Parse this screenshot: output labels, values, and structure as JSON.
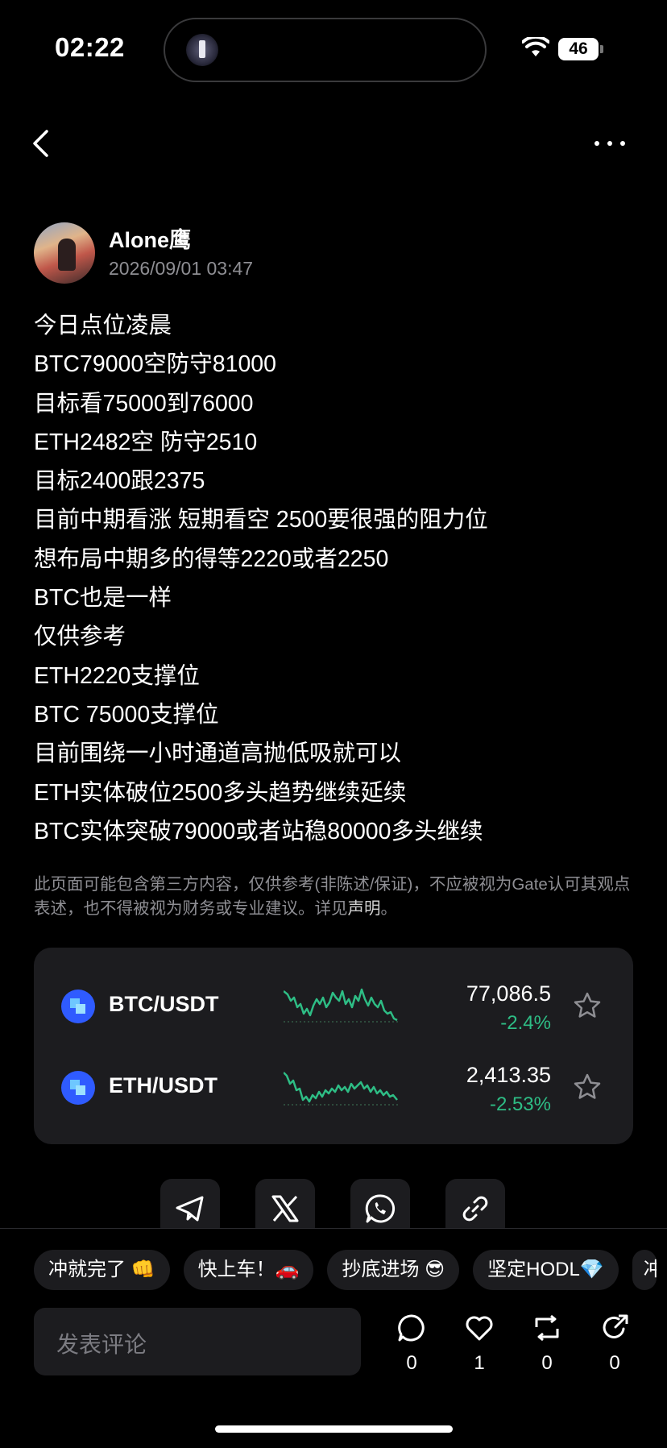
{
  "status": {
    "time": "02:22",
    "battery": "46"
  },
  "post": {
    "author": "Alone鹰",
    "date": "2026/09/01 03:47",
    "lines": [
      "今日点位凌晨",
      "BTC79000空防守81000",
      "目标看75000到76000",
      "ETH2482空 防守2510",
      "目标2400跟2375",
      "目前中期看涨 短期看空 2500要很强的阻力位",
      "想布局中期多的得等2220或者2250",
      "BTC也是一样",
      "仅供参考",
      "ETH2220支撑位",
      "BTC 75000支撑位",
      "目前围绕一小时通道高抛低吸就可以",
      "ETH实体破位2500多头趋势继续延续",
      "BTC实体突破79000或者站稳80000多头继续"
    ],
    "disclaimer": "此页面可能包含第三方内容，仅供参考(非陈述/保证)，不应被视为Gate认可其观点表述，也不得被视为财务或专业建议。详见",
    "disclaimer_link": "声明",
    "disclaimer_end": "。"
  },
  "market": [
    {
      "pair": "BTC/USDT",
      "price": "77,086.5",
      "change": "-2.4%"
    },
    {
      "pair": "ETH/USDT",
      "price": "2,413.35",
      "change": "-2.53%"
    }
  ],
  "colors": {
    "positive": "#2ebd85",
    "accent": "#2f5bff",
    "card": "#1c1c1f"
  },
  "share_icons": [
    "telegram-icon",
    "x-icon",
    "whatsapp-icon",
    "link-icon"
  ],
  "quick_replies": [
    "冲就完了 👊",
    "快上车！🚗",
    "抄底进场 😎",
    "坚定HODL💎",
    "冲"
  ],
  "comment_placeholder": "发表评论",
  "actions": {
    "comments": "0",
    "likes": "1",
    "reposts": "0",
    "shares": "0"
  }
}
